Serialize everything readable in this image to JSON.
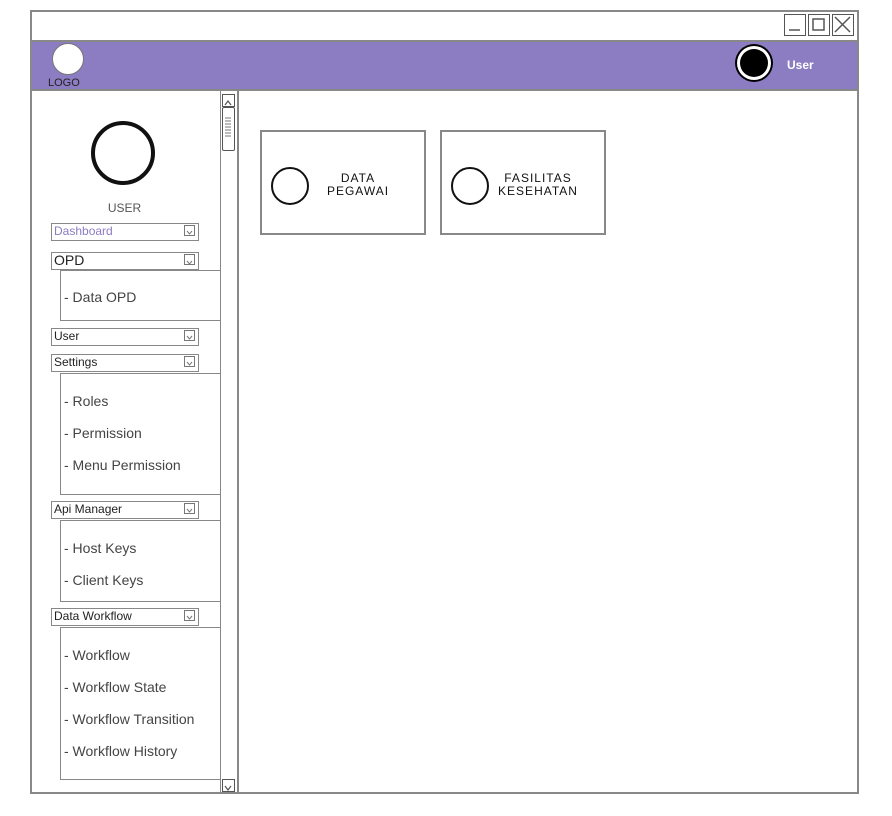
{
  "header": {
    "logo_label": "LOGO",
    "user_name": "User",
    "color": "#8c7cc2"
  },
  "sidebar": {
    "profile_label": "USER",
    "menus": [
      {
        "label": "Dashboard",
        "color": "#8c7cc2"
      },
      {
        "label": "OPD",
        "children": [
          "- Data OPD"
        ]
      },
      {
        "label": "User"
      },
      {
        "label": "Settings",
        "children": [
          "- Roles",
          "- Permission",
          "- Menu Permission"
        ]
      },
      {
        "label": "Api Manager",
        "children": [
          "- Host Keys",
          "- Client Keys"
        ]
      },
      {
        "label": "Data Workflow",
        "children": [
          "- Workflow",
          "- Workflow State",
          "- Workflow Transition",
          "- Workflow History"
        ]
      }
    ]
  },
  "cards": [
    {
      "label": "DATA\nPEGAWAI",
      "icon": "circle-icon"
    },
    {
      "label": "FASILITAS\nKESEHATAN",
      "icon": "circle-icon"
    }
  ],
  "window_controls": [
    "minimize-icon",
    "maximize-icon",
    "close-icon"
  ]
}
